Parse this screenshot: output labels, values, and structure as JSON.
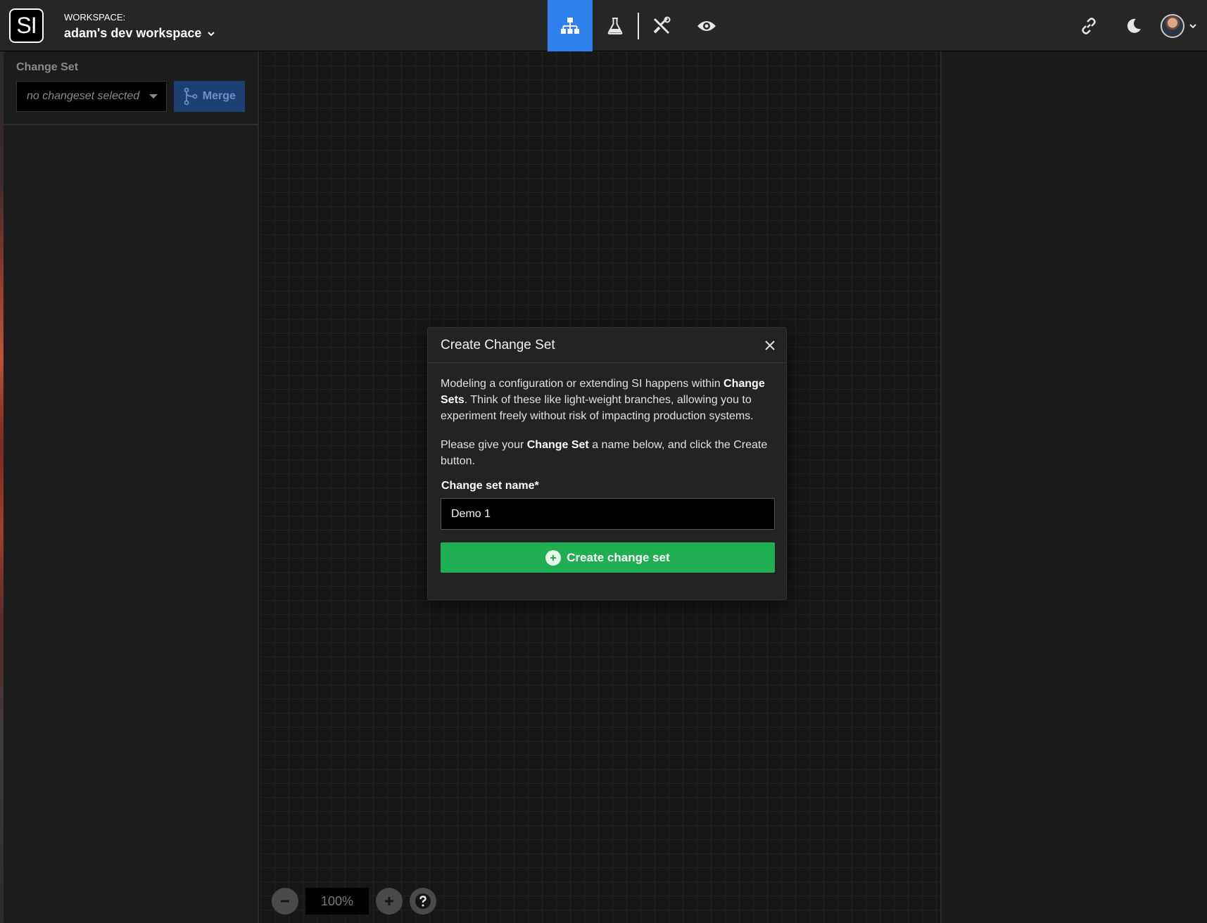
{
  "navbar": {
    "logo_text": "SI",
    "workspace_label": "WORKSPACE:",
    "workspace_name": "adam's dev workspace",
    "nav_icons": [
      "diagram-icon",
      "flask-icon",
      "tools-icon",
      "eye-icon"
    ],
    "active_nav": "diagram-icon",
    "right_icons": [
      "link-icon",
      "moon-icon",
      "avatar"
    ]
  },
  "sidebar": {
    "title": "Change Set",
    "select_placeholder": "no changeset selected",
    "merge_label": "Merge"
  },
  "canvas": {
    "zoom_value": "100%"
  },
  "modal": {
    "title": "Create Change Set",
    "para1_a": "Modeling a configuration or extending SI happens within ",
    "para1_bold": "Change Sets",
    "para1_b": ". Think of these like light-weight branches, allowing you to experiment freely without risk of impacting production systems.",
    "para2_a": "Please give your ",
    "para2_bold": "Change Set",
    "para2_b": " a name below, and click the Create button.",
    "field_label": "Change set name*",
    "field_value": "Demo 1",
    "create_label": "Create change set"
  },
  "colors": {
    "accent_blue": "#2f80ed",
    "create_green": "#1fae51",
    "merge_blue": "#1e3f73"
  }
}
